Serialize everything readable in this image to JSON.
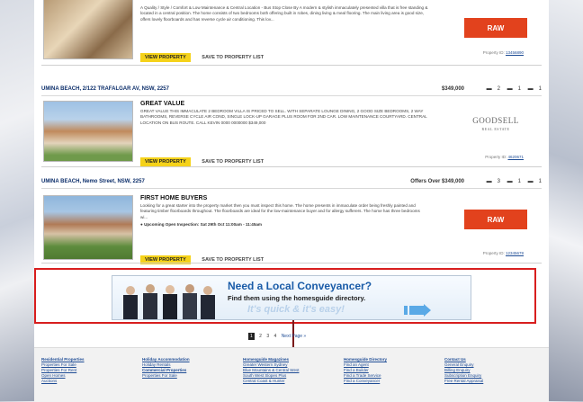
{
  "listings": [
    {
      "head_location": "",
      "head_price": "",
      "title": "",
      "description": "A Quality / Style / Comfort & Low Maintenance & Central Location - Bus Stop Close By A modern & stylish immaculately presented villa that is free standing & located in a central position. The home consists of two bedrooms both offering built in robes, dining living & meal flooring. The main living area is good size, offers lovely floorboards and has reverse cycle air conditioning. This lov...",
      "view_label": "VIEW PROPERTY",
      "save_label": "SAVE TO PROPERTY LIST",
      "agent": "RAW",
      "property_id_label": "Property ID:",
      "property_id": "13456890"
    },
    {
      "head_location": "UMINA BEACH, 2/122 TRAFALGAR AV, NSW, 2257",
      "head_price": "$349,000",
      "beds": "2",
      "baths": "1",
      "cars": "1",
      "title": "GREAT VALUE",
      "description": "GREAT VALUE THIS IMMACULATE 2 BEDROOM VILLA IS PRICED TO SELL. WITH SEPARATE LOUNGE DINING, 2 GOOD SIZE BEDROOMS, 2 WAY BATHROOMS, REVERSE CYCLE AIR COND, SINGLE LOCK-UP GARAGE PLUS ROOM FOR 2ND CAR. LOW MAINTENANCE COURTYARD. CENTRAL LOCATION ON BUS ROUTE. CALL KEVIN 0000 0000000 $349,000",
      "view_label": "VIEW PROPERTY",
      "save_label": "SAVE TO PROPERTY LIST",
      "agent": "GOODSELL",
      "agent_sub": "REAL ESTATE",
      "property_id_label": "Property ID:",
      "property_id": "4620671"
    },
    {
      "head_location": "UMINA BEACH, Nemo Street, NSW, 2257",
      "head_price": "Offers Over $349,000",
      "beds": "3",
      "baths": "1",
      "cars": "1",
      "title": "FIRST HOME BUYERS",
      "description": "Looking for a great starter into the property market then you must inspect this home. The home presents in immaculate order being freshly painted and featuring timber floorboards throughout. The floorboards are ideal for the low-maintenance buyer and for allergy sufferers. The home has three bedrooms wi...",
      "inspection": "Upcoming Open Inspection: Sat 29th Oct 11:00am - 11:45am",
      "view_label": "VIEW PROPERTY",
      "save_label": "SAVE TO PROPERTY LIST",
      "agent": "RAW",
      "property_id_label": "Property ID:",
      "property_id": "12345678"
    }
  ],
  "banner": {
    "line1": "Need a Local Conveyancer?",
    "line2": "Find them using the homesguide directory.",
    "line3": "It's quick & it's easy!"
  },
  "pager": {
    "pages": [
      "1",
      "2",
      "3",
      "4"
    ],
    "next": "Next Page »"
  },
  "footer": [
    {
      "heading": "Residential Properties",
      "links": [
        "Properties For Sale",
        "Properties For Rent",
        "Open Homes",
        "Auctions"
      ]
    },
    {
      "heading": "Holiday Accommodation",
      "links": [
        "Holiday Rentals",
        "",
        "Commercial Properties",
        "Properties For Sale"
      ]
    },
    {
      "heading": "Homesguide Magazines",
      "links": [
        "Greater Western Sydney",
        "Blue Mountains & Central West",
        "South West Slopes Plus",
        "Central Coast & Hunter"
      ]
    },
    {
      "heading": "Homesguide Directory",
      "links": [
        "Find an Agent",
        "Find a Builder",
        "Find a Trade Service",
        "Find a Conveyancer"
      ]
    },
    {
      "heading": "Contact Us",
      "links": [
        "General Enquiry",
        "Billing Enquiry",
        "Subscription Enquiry",
        "Free Rental Appraisal"
      ]
    }
  ]
}
